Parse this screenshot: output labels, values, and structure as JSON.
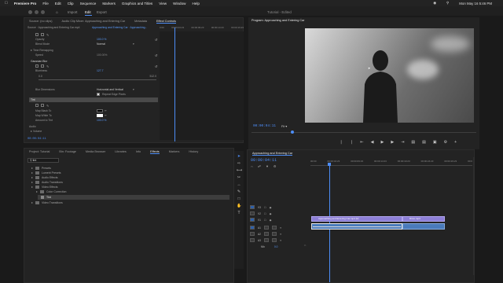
{
  "menubar": {
    "app": "Premiere Pro",
    "items": [
      "File",
      "Edit",
      "Clip",
      "Sequence",
      "Markers",
      "Graphics and Titles",
      "View",
      "Window",
      "Help"
    ],
    "clock": "Mon May 16 5:46 PM"
  },
  "nav": {
    "import": "Import",
    "edit": "Edit",
    "export": "Export"
  },
  "window_title": "Tutorial - Edited",
  "effect_controls": {
    "tabs": [
      "Source: (no clips)",
      "Audio Clip Mixer: Approaching and Entering Car",
      "Metadata",
      "Effect Controls"
    ],
    "source_label": "Source · Approaching and Entering Car.mp4",
    "clip_label": "Approaching and Entering Car · Approaching...",
    "timecodes": [
      "0:00",
      "00:00:04:23",
      "00:00:09:23",
      "00:00:14:23",
      "00:00:19:23"
    ],
    "rows": [
      {
        "label": "Opacity",
        "value": "100.0 %"
      },
      {
        "label": "Blend Mode",
        "value": "Normal"
      },
      {
        "label": "Time Remapping",
        "value": ""
      },
      {
        "label": "Speed",
        "value": "100.00%"
      },
      {
        "label": "Gaussian Blur",
        "value": ""
      },
      {
        "label": "Blurriness",
        "value": "127.7"
      },
      {
        "label": "0.0",
        "value": "512.0"
      },
      {
        "label": "Blur Dimensions",
        "value": "Horizontal and Vertical"
      },
      {
        "label": "Repeat Edge Pixels",
        "value": ""
      },
      {
        "label": "Tint",
        "value": ""
      },
      {
        "label": "Map Black To",
        "value": ""
      },
      {
        "label": "Map White To",
        "value": ""
      },
      {
        "label": "Amount to Tint",
        "value": "100.0 %"
      },
      {
        "label": "Audio",
        "value": ""
      },
      {
        "label": "Volume",
        "value": ""
      }
    ],
    "current_tc": "00:00:04:11"
  },
  "program": {
    "title": "Program: Approaching and Entering Car",
    "tc": "00:00:04:11",
    "fit": "Fit"
  },
  "project": {
    "tabs": [
      "Project: Tutorial",
      "Bin: Footage",
      "Media Browser",
      "Libraries",
      "Info",
      "Effects",
      "Markers",
      "History"
    ],
    "search": "tint",
    "tree": [
      "Presets",
      "Lumetri Presets",
      "Audio Effects",
      "Audio Transitions",
      "Video Effects",
      "Color Correction",
      "Tint",
      "Video Transitions"
    ]
  },
  "timeline": {
    "title": "Approaching and Entering Car",
    "tc": "00:00:04:11",
    "ruler": [
      "00:00",
      "00:00:04:23",
      "00:00:09:23",
      "00:00:14:23",
      "00:00:19:23",
      "00:00:24:23",
      "00:00:29:23",
      "00:0"
    ],
    "tracks": [
      "V3",
      "V2",
      "V1",
      "A1",
      "A2",
      "A3",
      "Mix"
    ],
    "clip_v1": "Approaching and Entering Car.mp4 [V]",
    "clip_v1b": "Drive.mp4",
    "mix_value": "0.0"
  },
  "colors": {
    "accent": "#4d8df6",
    "clip_video": "#8d7fd6",
    "clip_audio": "#4a7bbb"
  }
}
